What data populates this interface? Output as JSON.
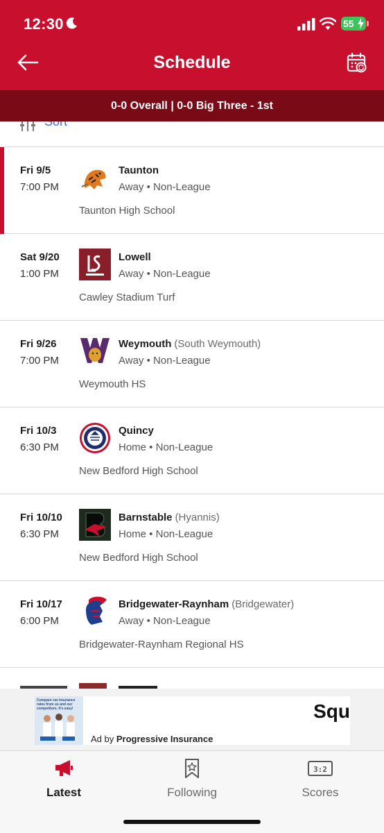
{
  "status_bar": {
    "time": "12:30",
    "battery": "55"
  },
  "header": {
    "title": "Schedule"
  },
  "record": "0-0 Overall | 0-0 Big Three - 1st",
  "sort": {
    "label": "Sort"
  },
  "games": [
    {
      "date": "Fri 9/5",
      "time": "7:00 PM",
      "opponent": "Taunton",
      "town": "",
      "location": "Away",
      "league": "Non-League",
      "venue": "Taunton High School",
      "logo": "tiger-logo-icon"
    },
    {
      "date": "Sat 9/20",
      "time": "1:00 PM",
      "opponent": "Lowell",
      "town": "",
      "location": "Away",
      "league": "Non-League",
      "venue": "Cawley Stadium Turf",
      "logo": "lowell-logo-icon"
    },
    {
      "date": "Fri 9/26",
      "time": "7:00 PM",
      "opponent": "Weymouth",
      "town": "(South Weymouth)",
      "location": "Away",
      "league": "Non-League",
      "venue": "Weymouth HS",
      "logo": "weymouth-logo-icon"
    },
    {
      "date": "Fri 10/3",
      "time": "6:30 PM",
      "opponent": "Quincy",
      "town": "",
      "location": "Home",
      "league": "Non-League",
      "venue": "New Bedford High School",
      "logo": "quincy-logo-icon"
    },
    {
      "date": "Fri 10/10",
      "time": "6:30 PM",
      "opponent": "Barnstable",
      "town": "(Hyannis)",
      "location": "Home",
      "league": "Non-League",
      "venue": "New Bedford High School",
      "logo": "barnstable-logo-icon"
    },
    {
      "date": "Fri 10/17",
      "time": "6:00 PM",
      "opponent": "Bridgewater-Raynham",
      "town": "(Bridgewater)",
      "location": "Away",
      "league": "Non-League",
      "venue": "Bridgewater-Raynham Regional HS",
      "logo": "trojan-logo-icon"
    }
  ],
  "ad": {
    "headline": "Squ",
    "by_prefix": "Ad by",
    "advertiser": "Progressive Insurance",
    "thumb_text": "Compare car insurance rates from us and our competitors. It's easy!"
  },
  "tabs": [
    {
      "label": "Latest",
      "icon": "megaphone-icon",
      "active": true
    },
    {
      "label": "Following",
      "icon": "bookmark-star-icon",
      "active": false
    },
    {
      "label": "Scores",
      "icon": "scoreboard-icon",
      "active": false
    }
  ],
  "colors": {
    "brand_red": "#c8102e",
    "record_bar": "#7a0a16",
    "link_blue": "#3d6ad6"
  }
}
